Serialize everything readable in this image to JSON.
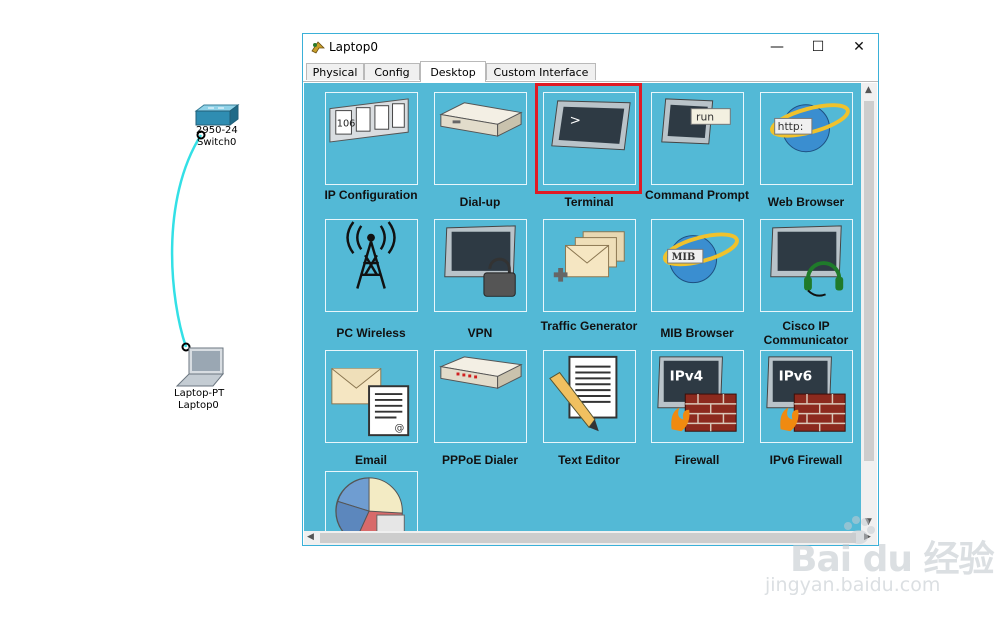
{
  "topology": {
    "switch": {
      "model": "2950-24",
      "name": "Switch0"
    },
    "laptop": {
      "model": "Laptop-PT",
      "name": "Laptop0"
    }
  },
  "window": {
    "title": "Laptop0",
    "controls": {
      "minimize": "—",
      "maximize": "☐",
      "close": "✕"
    }
  },
  "tabs": [
    {
      "label": "Physical",
      "active": false
    },
    {
      "label": "Config",
      "active": false
    },
    {
      "label": "Desktop",
      "active": true
    },
    {
      "label": "Custom Interface",
      "active": false
    }
  ],
  "desktop": {
    "apps": [
      {
        "label": "IP Configuration",
        "icon": "ip-configuration-icon",
        "text": "106"
      },
      {
        "label": "Dial-up",
        "icon": "dialup-modem-icon"
      },
      {
        "label": "Terminal",
        "icon": "terminal-icon",
        "text": ">",
        "highlighted": true
      },
      {
        "label": "Command Prompt",
        "icon": "command-prompt-icon",
        "text": "run"
      },
      {
        "label": "Web Browser",
        "icon": "web-browser-icon",
        "text": "http:"
      },
      {
        "label": "PC Wireless",
        "icon": "wireless-tower-icon"
      },
      {
        "label": "VPN",
        "icon": "vpn-lock-icon"
      },
      {
        "label": "Traffic Generator",
        "icon": "traffic-generator-icon"
      },
      {
        "label": "MIB Browser",
        "icon": "mib-browser-icon",
        "text": "MIB"
      },
      {
        "label": "Cisco IP Communicator",
        "icon": "ip-communicator-icon"
      },
      {
        "label": "Email",
        "icon": "email-icon"
      },
      {
        "label": "PPPoE Dialer",
        "icon": "pppoe-dialer-icon"
      },
      {
        "label": "Text Editor",
        "icon": "text-editor-icon"
      },
      {
        "label": "Firewall",
        "icon": "firewall-icon",
        "text": "IPv4"
      },
      {
        "label": "IPv6 Firewall",
        "icon": "ipv6-firewall-icon",
        "text": "IPv6"
      },
      {
        "label": "",
        "icon": "pie-chart-app-icon"
      }
    ]
  },
  "watermark": {
    "brand": "Bai du 经验",
    "url": "jingyan.baidu.com"
  },
  "colors": {
    "desktop_bg": "#53b9d6",
    "highlight": "#e01b24",
    "window_border": "#3ab0d8",
    "link_cable": "#33e0e6"
  }
}
